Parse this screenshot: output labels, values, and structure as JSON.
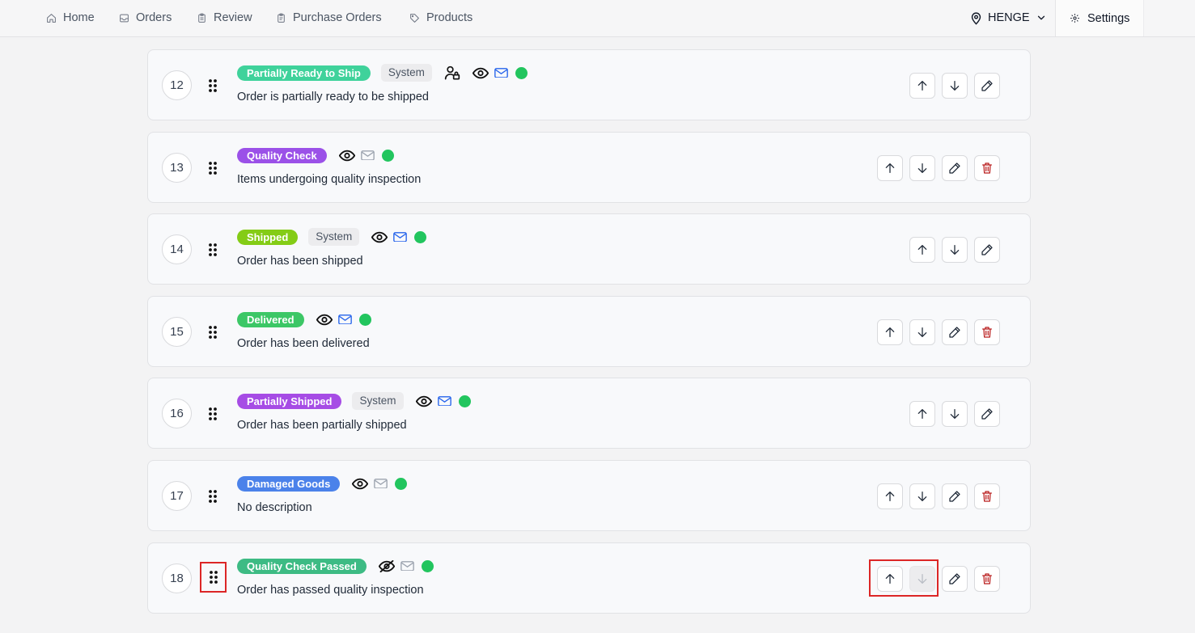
{
  "nav": {
    "items": [
      {
        "label": "Home",
        "icon": "home-icon"
      },
      {
        "label": "Orders",
        "icon": "inbox-icon"
      },
      {
        "label": "Review",
        "icon": "clipboard-icon"
      },
      {
        "label": "Purchase Orders",
        "icon": "clipboard-list-icon"
      },
      {
        "label": "Products",
        "icon": "tag-icon"
      }
    ],
    "location": "HENGE",
    "settings": "Settings"
  },
  "statuses": [
    {
      "num": "12",
      "label": "Partially Ready to Ship",
      "color": "#3fd29b",
      "system": "System",
      "desc": "Order is partially ready to be shipped",
      "customer": true,
      "visible": true,
      "email": true,
      "delete": false
    },
    {
      "num": "13",
      "label": "Quality Check",
      "color": "#9b51e8",
      "system": "",
      "desc": "Items undergoing quality inspection",
      "customer": false,
      "visible": true,
      "email": false,
      "delete": true
    },
    {
      "num": "14",
      "label": "Shipped",
      "color": "#84cc16",
      "system": "System",
      "desc": "Order has been shipped",
      "customer": false,
      "visible": true,
      "email": true,
      "delete": false
    },
    {
      "num": "15",
      "label": "Delivered",
      "color": "#3cc766",
      "system": "",
      "desc": "Order has been delivered",
      "customer": false,
      "visible": true,
      "email": true,
      "delete": true
    },
    {
      "num": "16",
      "label": "Partially Shipped",
      "color": "#a64ce5",
      "system": "System",
      "desc": "Order has been partially shipped",
      "customer": false,
      "visible": true,
      "email": true,
      "delete": false
    },
    {
      "num": "17",
      "label": "Damaged Goods",
      "color": "#4b82ea",
      "system": "",
      "desc": "No description",
      "customer": false,
      "visible": true,
      "email": false,
      "delete": true
    },
    {
      "num": "18",
      "label": "Quality Check Passed",
      "color": "#3dbb84",
      "system": "",
      "desc": "Order has passed quality inspection",
      "customer": false,
      "visible": false,
      "email": false,
      "delete": true,
      "last": true
    }
  ]
}
